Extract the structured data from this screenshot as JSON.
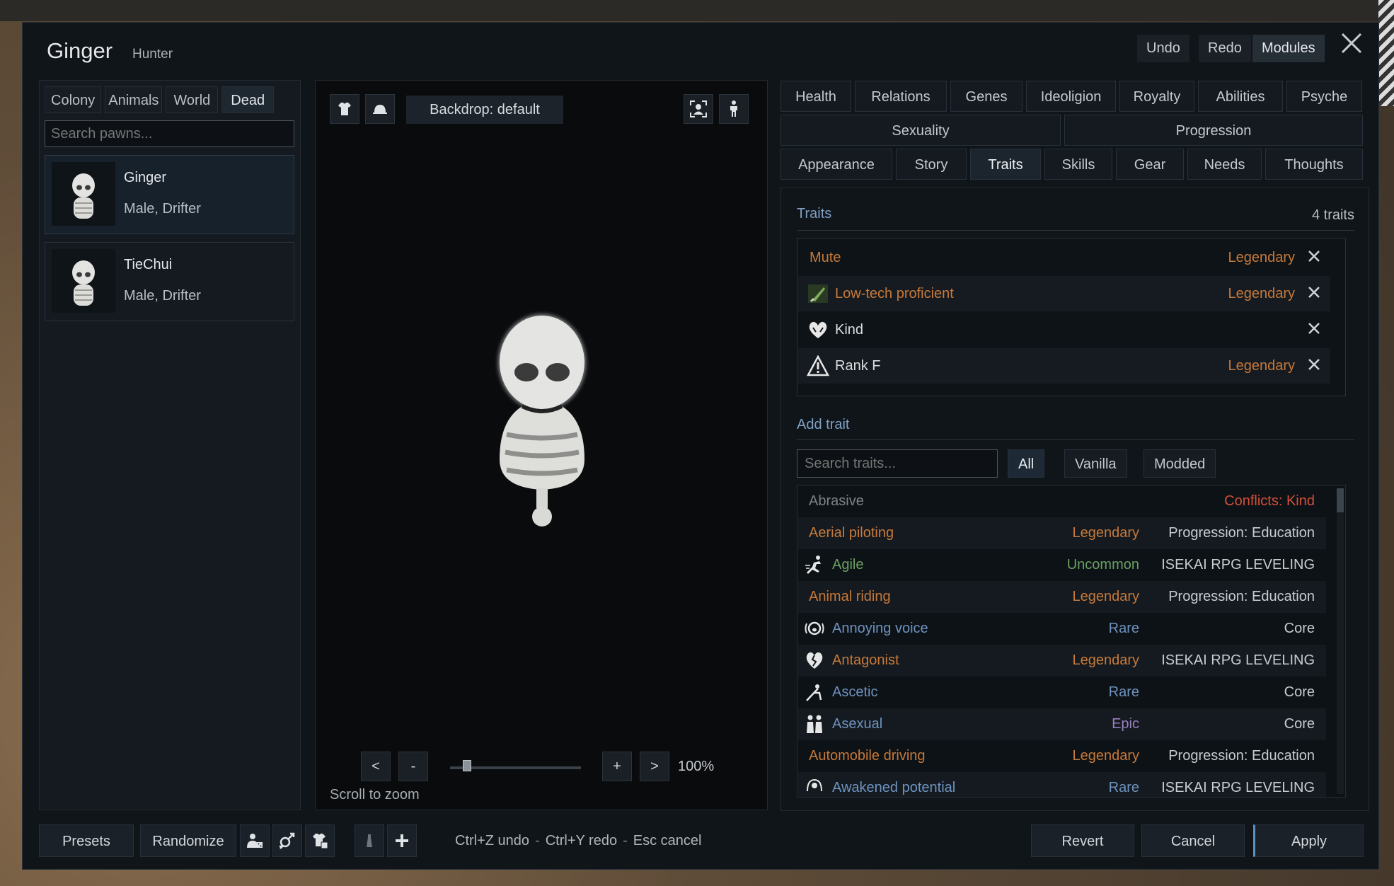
{
  "window": {
    "pawn_name": "Ginger",
    "pawn_role": "Hunter",
    "undo_label": "Undo",
    "redo_label": "Redo",
    "modules_label": "Modules"
  },
  "left": {
    "tabs": [
      "Colony",
      "Animals",
      "World",
      "Dead"
    ],
    "active_tab": "Dead",
    "search_placeholder": "Search pawns...",
    "pawns": [
      {
        "name": "Ginger",
        "desc": "Male, Drifter"
      },
      {
        "name": "TieChui",
        "desc": "Male, Drifter"
      }
    ]
  },
  "center": {
    "backdrop_label": "Backdrop: default",
    "zoom_prev": "<",
    "zoom_minus": "-",
    "zoom_plus": "+",
    "zoom_next": ">",
    "zoom_percent": "100%",
    "zoom_level": 0.1,
    "scroll_hint": "Scroll to zoom"
  },
  "tabs": {
    "row1": [
      "Health",
      "Relations",
      "Genes",
      "Ideoligion",
      "Royalty",
      "Abilities",
      "Psyche"
    ],
    "row2": [
      "Sexuality",
      "Progression"
    ],
    "row3": [
      "Appearance",
      "Story",
      "Traits",
      "Skills",
      "Gear",
      "Needs",
      "Thoughts"
    ],
    "active": "Traits"
  },
  "traits": {
    "section_title": "Traits",
    "count_label": "4 traits",
    "current": [
      {
        "name": "Mute",
        "rarity": "Legendary",
        "icon": "none",
        "color": "#c7793a"
      },
      {
        "name": "Low-tech proficient",
        "rarity": "Legendary",
        "icon": "knife-icon",
        "color": "#c7793a"
      },
      {
        "name": "Kind",
        "rarity": "",
        "icon": "heart-hands-icon",
        "color": "#d9dde0"
      },
      {
        "name": "Rank F",
        "rarity": "Legendary",
        "icon": "warning-triangle-icon",
        "color": "#d9dde0"
      }
    ],
    "add_title": "Add trait",
    "search_placeholder": "Search traits...",
    "filters": [
      "All",
      "Vanilla",
      "Modded"
    ],
    "active_filter": "All",
    "available": [
      {
        "name": "Abrasive",
        "rarity": "",
        "source": "Conflicts: Kind",
        "icon": "none",
        "name_class": "col-dim",
        "rarity_class": "",
        "source_class": "col-conflict"
      },
      {
        "name": "Aerial piloting",
        "rarity": "Legendary",
        "source": "Progression: Education",
        "icon": "none",
        "name_class": "col-legendary",
        "rarity_class": "col-legendary",
        "source_class": ""
      },
      {
        "name": "Agile",
        "rarity": "Uncommon",
        "source": "ISEKAI RPG LEVELING",
        "icon": "runner-icon",
        "name_class": "col-uncommon",
        "rarity_class": "col-uncommon",
        "source_class": ""
      },
      {
        "name": "Animal riding",
        "rarity": "Legendary",
        "source": "Progression: Education",
        "icon": "none",
        "name_class": "col-legendary",
        "rarity_class": "col-legendary",
        "source_class": ""
      },
      {
        "name": "Annoying voice",
        "rarity": "Rare",
        "source": "Core",
        "icon": "shouting-icon",
        "name_class": "col-rare",
        "rarity_class": "col-rare",
        "source_class": ""
      },
      {
        "name": "Antagonist",
        "rarity": "Legendary",
        "source": "ISEKAI RPG LEVELING",
        "icon": "broken-heart-icon",
        "name_class": "col-legendary",
        "rarity_class": "col-legendary",
        "source_class": ""
      },
      {
        "name": "Ascetic",
        "rarity": "Rare",
        "source": "Core",
        "icon": "ascetic-icon",
        "name_class": "col-rare",
        "rarity_class": "col-rare",
        "source_class": ""
      },
      {
        "name": "Asexual",
        "rarity": "Epic",
        "source": "Core",
        "icon": "people-icon",
        "name_class": "col-rare",
        "rarity_class": "col-epic",
        "source_class": ""
      },
      {
        "name": "Automobile driving",
        "rarity": "Legendary",
        "source": "Progression: Education",
        "icon": "none",
        "name_class": "col-legendary",
        "rarity_class": "col-legendary",
        "source_class": ""
      },
      {
        "name": "Awakened potential",
        "rarity": "Rare",
        "source": "ISEKAI RPG LEVELING",
        "icon": "aura-icon",
        "name_class": "col-rare",
        "rarity_class": "col-rare",
        "source_class": ""
      }
    ]
  },
  "bottom": {
    "presets_label": "Presets",
    "randomize_label": "Randomize",
    "undo_hint": "Ctrl+Z undo",
    "redo_hint": "Ctrl+Y redo",
    "cancel_hint": "Esc cancel",
    "sep": "-",
    "revert_label": "Revert",
    "cancel_label": "Cancel",
    "apply_label": "Apply"
  }
}
